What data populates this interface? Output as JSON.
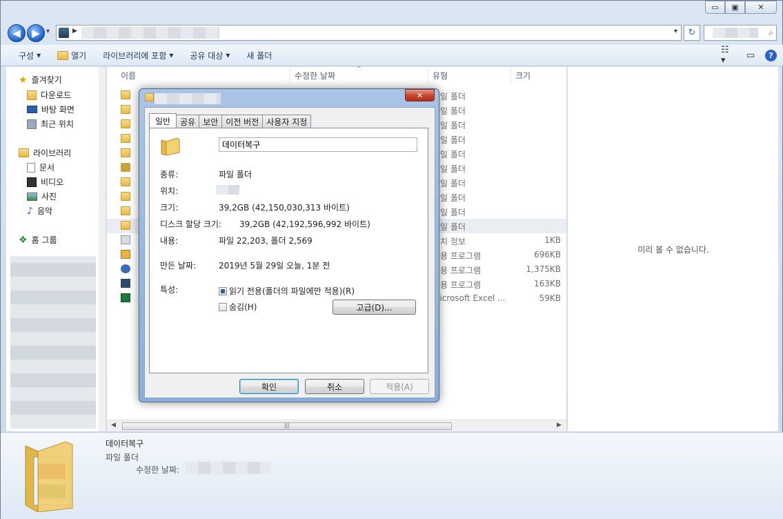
{
  "window": {
    "minimize_label": "▭",
    "maximize_label": "▣",
    "close_label": "✕"
  },
  "address": {
    "back_label": "◀",
    "forward_label": "▶",
    "dropdown_glyph": "▾",
    "refresh_glyph": "↻",
    "search_glyph": "⌕"
  },
  "toolbar": {
    "organize": "구성",
    "open": "열기",
    "include_library": "라이브러리에 포함",
    "share_with": "공유 대상",
    "new_folder": "새 폴더",
    "dropdown_glyph": "▾"
  },
  "nav": {
    "favorites": "즐겨찾기",
    "downloads": "다운로드",
    "desktop": "바탕 화면",
    "recent": "최근 위치",
    "libraries": "라이브러리",
    "documents": "문서",
    "videos": "비디오",
    "pictures": "사진",
    "music": "음악",
    "homegroup": "홈 그룹"
  },
  "columns": {
    "name": "이름",
    "date_modified": "수정한 날짜",
    "type": "유형",
    "size": "크기"
  },
  "files": [
    {
      "type": "파일 폴더",
      "size": ""
    },
    {
      "type": "파일 폴더",
      "size": ""
    },
    {
      "type": "파일 폴더",
      "size": ""
    },
    {
      "type": "파일 폴더",
      "size": ""
    },
    {
      "type": "파일 폴더",
      "size": ""
    },
    {
      "type": "파일 폴더",
      "size": ""
    },
    {
      "type": "파일 폴더",
      "size": ""
    },
    {
      "type": "파일 폴더",
      "size": ""
    },
    {
      "type": "파일 폴더",
      "size": ""
    },
    {
      "type": "파일 폴더",
      "size": ""
    },
    {
      "type": "설치 정보",
      "size": "1KB"
    },
    {
      "type": "응용 프로그램",
      "size": "696KB"
    },
    {
      "type": "응용 프로그램",
      "size": "1,375KB"
    },
    {
      "type": "응용 프로그램",
      "size": "163KB"
    },
    {
      "type": "Microsoft Excel ...",
      "size": "59KB"
    }
  ],
  "preview": {
    "empty_text": "미리 볼 수 없습니다."
  },
  "details": {
    "name": "데이터복구",
    "type": "파일 폴더",
    "modified_label": "수정한 날짜:"
  },
  "dialog": {
    "close_label": "✕",
    "tabs": [
      "일반",
      "공유",
      "보안",
      "이전 버전",
      "사용자 지정"
    ],
    "folder_name": "데이터복구",
    "type_label": "종류:",
    "type_value": "파일 폴더",
    "location_label": "위치:",
    "size_label": "크기:",
    "size_value": "39,2GB (42,150,030,313 바이트)",
    "disk_size_label": "디스크 할당 크기:",
    "disk_size_value": "39,2GB (42,192,596,992 바이트)",
    "contains_label": "내용:",
    "contains_value": "파일 22,203, 폴더 2,569",
    "created_label": "만든 날짜:",
    "created_value": "2019년 5월 29일 오늘, 1분 전",
    "attributes_label": "특성:",
    "readonly_label": "읽기 전용(폴더의 파일에만 적용)(R)",
    "hidden_label": "숨김(H)",
    "advanced_button": "고급(D)...",
    "ok_button": "확인",
    "cancel_button": "취소",
    "apply_button": "적용(A)"
  },
  "colors": {
    "accent": "#2a62c9",
    "folder": "#e7b84a"
  }
}
